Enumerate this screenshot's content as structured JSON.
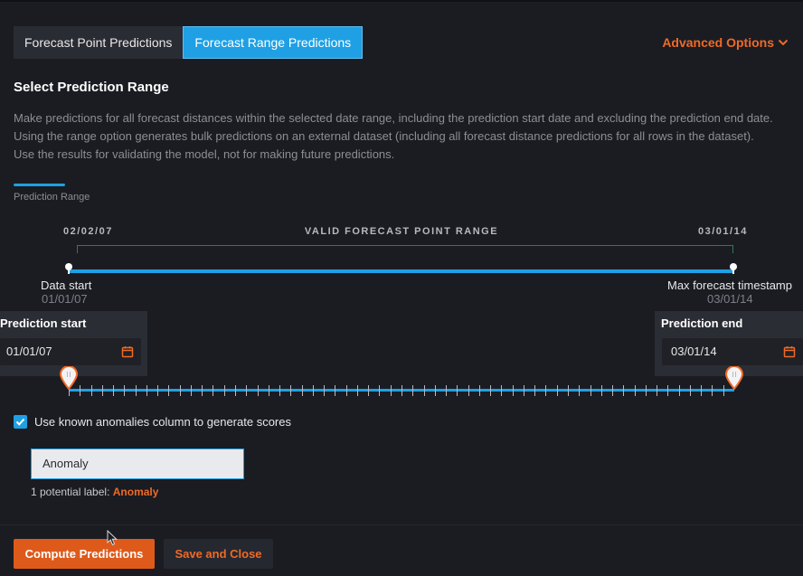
{
  "tabs": [
    {
      "label": "Forecast Point Predictions",
      "active": false
    },
    {
      "label": "Forecast Range Predictions",
      "active": true
    }
  ],
  "advanced_options": "Advanced Options",
  "section_title": "Select Prediction Range",
  "description": "Make predictions for all forecast distances within the selected date range, including the prediction start date and excluding the prediction end date. Using the range option generates bulk predictions on an external dataset (including all forecast distance predictions for all rows in the dataset). Use the results for validating the model, not for making future predictions.",
  "range_tab_label": "Prediction Range",
  "timeline": {
    "valid_start": "02/02/07",
    "valid_label": "VALID FORECAST POINT RANGE",
    "valid_end": "03/01/14",
    "data_start_label": "Data start",
    "data_start_date": "01/01/07",
    "max_label": "Max forecast timestamp",
    "max_date": "03/01/14"
  },
  "prediction_start": {
    "title": "Prediction start",
    "value": "01/01/07"
  },
  "prediction_end": {
    "title": "Prediction end",
    "value": "03/01/14"
  },
  "slider": {
    "start_fraction": 0.0,
    "end_fraction": 1.0
  },
  "anomaly_checkbox": {
    "label": "Use known anomalies column to generate scores",
    "checked": true
  },
  "anomaly_input": {
    "value": "Anomaly"
  },
  "potential_label": {
    "prefix": "1 potential label:",
    "value": "Anomaly"
  },
  "buttons": {
    "compute": "Compute Predictions",
    "save_close": "Save and Close"
  },
  "colors": {
    "accent_blue": "#1fa0e4",
    "accent_orange": "#f06a26",
    "background": "#1a1c22"
  }
}
